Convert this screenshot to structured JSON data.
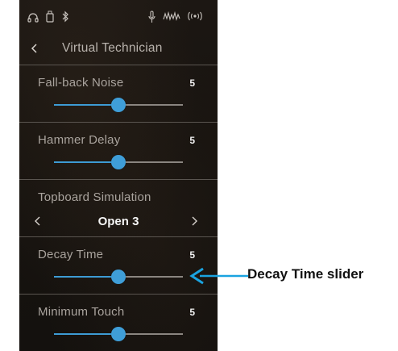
{
  "colors": {
    "accent": "#3d9bd4",
    "panel_background": "#17130f",
    "divider": "#5a5550",
    "label_text": "#a9a39d",
    "value_text": "#f2f2f2",
    "callout_arrow": "#1aa3e0"
  },
  "status_bar": {
    "icons": [
      "headphones-icon",
      "usb-icon",
      "bluetooth-icon",
      "microphone-icon",
      "wave-signal-icon",
      "wireless-icon"
    ]
  },
  "header": {
    "back_icon": "chevron-left-icon",
    "title": "Virtual Technician"
  },
  "settings": {
    "fallback_noise": {
      "label": "Fall-back Noise",
      "value": "5",
      "level": 0.5
    },
    "hammer_delay": {
      "label": "Hammer Delay",
      "value": "5",
      "level": 0.5
    },
    "topboard": {
      "label": "Topboard Simulation",
      "value": "Open 3",
      "prev_icon": "chevron-left-icon",
      "next_icon": "chevron-right-icon"
    },
    "decay_time": {
      "label": "Decay Time",
      "value": "5",
      "level": 0.5
    },
    "minimum_touch": {
      "label": "Minimum Touch",
      "value": "5",
      "level": 0.5
    }
  },
  "callout": {
    "label": "Decay Time slider"
  }
}
